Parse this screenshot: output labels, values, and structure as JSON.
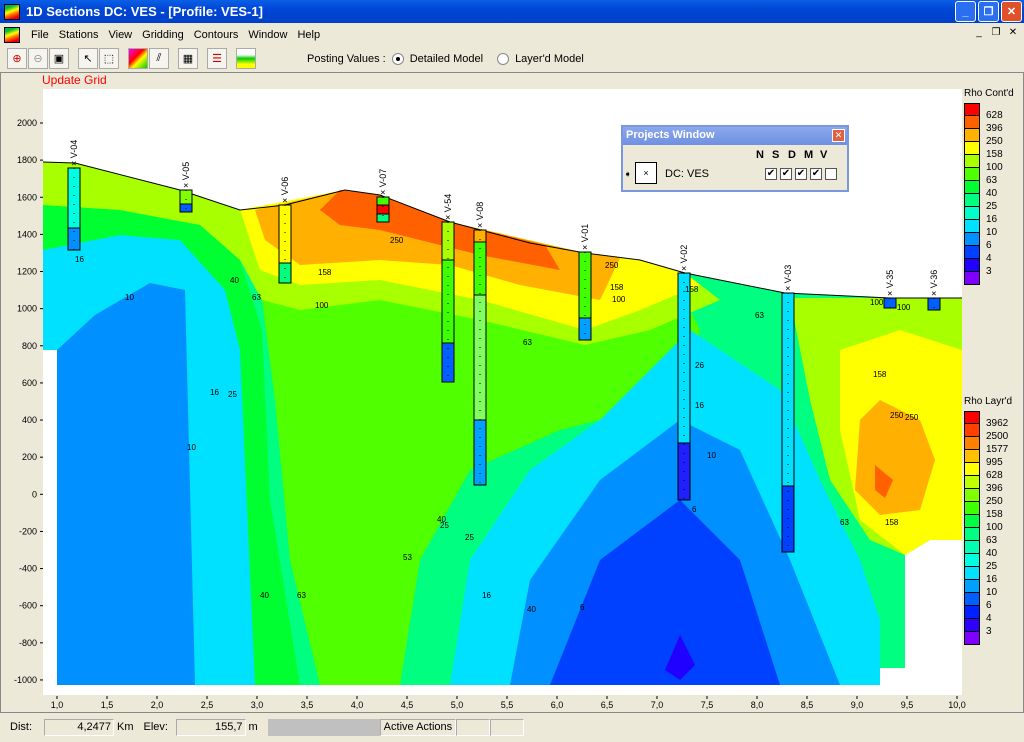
{
  "window": {
    "title": "1D Sections  DC: VES - [Profile: VES-1]",
    "buttons": [
      "_",
      "❐",
      "✕"
    ]
  },
  "menu": [
    "File",
    "Stations",
    "View",
    "Gridding",
    "Contours",
    "Window",
    "Help"
  ],
  "toolbar": {
    "posting_label": "Posting Values :",
    "detailed_label": "Detailed Model",
    "layered_label": "Layer'd Model",
    "selected": "Detailed Model"
  },
  "update_grid": "Update Grid",
  "plot": {
    "y_ticks": [
      "2000",
      "1800",
      "1600",
      "1400",
      "1200",
      "1000",
      "800",
      "600",
      "400",
      "200",
      "0",
      "-200",
      "-400",
      "-600",
      "-800",
      "-1000"
    ],
    "x_ticks": [
      "1,0",
      "1,5",
      "2,0",
      "2,5",
      "3,0",
      "3,5",
      "4,0",
      "4,5",
      "5,0",
      "5,5",
      "6,0",
      "6,5",
      "7,0",
      "7,5",
      "8,0",
      "8,5",
      "9,0",
      "9,5",
      "10,0"
    ],
    "stations": [
      "× V-04",
      "× V-05",
      "× V-06",
      "× V-07",
      "× V-54",
      "× V-08",
      "× V-01",
      "× V-02",
      "× V-03",
      "× V-35",
      "× V-36"
    ],
    "contour_labels": [
      "16",
      "10",
      "40",
      "63",
      "16",
      "25",
      "10",
      "158",
      "100",
      "250",
      "250",
      "158",
      "100",
      "63",
      "250",
      "158",
      "100",
      "63",
      "26",
      "16",
      "10",
      "6",
      "40",
      "25",
      "53",
      "63",
      "40",
      "16",
      "6",
      "100",
      "158",
      "250",
      "63",
      "158",
      "40",
      "25"
    ]
  },
  "legend_contd": {
    "title": "Rho Cont'd",
    "labels": [
      "628",
      "396",
      "250",
      "158",
      "100",
      "63",
      "40",
      "25",
      "16",
      "10",
      "6",
      "4",
      "3"
    ],
    "colors": [
      "#ff0000",
      "#ff6000",
      "#ffb000",
      "#ffff00",
      "#a8ff00",
      "#50ff00",
      "#00ff30",
      "#00ff80",
      "#00ffc8",
      "#00e0ff",
      "#0090ff",
      "#0040ff",
      "#2000ff",
      "#8000ff"
    ]
  },
  "legend_layrd": {
    "title": "Rho Layr'd",
    "labels": [
      "3962",
      "2500",
      "1577",
      "995",
      "628",
      "396",
      "250",
      "158",
      "100",
      "63",
      "40",
      "25",
      "16",
      "10",
      "6",
      "4",
      "3"
    ],
    "colors": [
      "#ff0000",
      "#ff4000",
      "#ff8000",
      "#ffc000",
      "#ffff00",
      "#c0ff00",
      "#80ff00",
      "#40ff00",
      "#00ff40",
      "#00ff80",
      "#00ffb0",
      "#00ffe0",
      "#00e0ff",
      "#00a0ff",
      "#0060ff",
      "#0020ff",
      "#3000ff",
      "#8000ff"
    ]
  },
  "projects_window": {
    "title": "Projects Window",
    "project": "DC: VES",
    "columns": [
      "N",
      "S",
      "D",
      "M",
      "V"
    ],
    "checked": [
      true,
      true,
      true,
      true,
      false
    ]
  },
  "status": {
    "dist_label": "Dist:",
    "dist_value": "4,2477",
    "dist_unit": "Km",
    "elev_label": "Elev:",
    "elev_value": "155,7",
    "elev_unit": "m",
    "active_actions": "Active Actions"
  }
}
